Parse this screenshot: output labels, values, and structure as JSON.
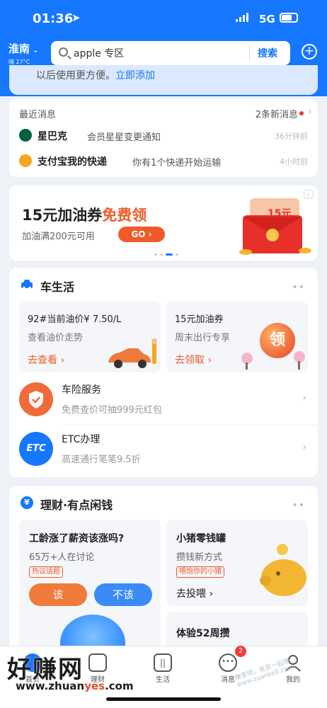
{
  "status_bar": {
    "time": "01:36",
    "network": "5G"
  },
  "header": {
    "city": "淮南",
    "weather": "晴 27°C",
    "search_query": "apple 专区",
    "search_button": "搜索"
  },
  "banner": {
    "text": "以后使用更方便。",
    "link": "立即添加"
  },
  "messages": {
    "title": "最近消息",
    "new_count": "2条新消息",
    "items": [
      {
        "name": "星巴克",
        "text": "会员星星变更通知",
        "time": "36分钟前"
      },
      {
        "name": "支付宝我的快递",
        "text": "你有1个快递开始运输",
        "time": "4小时前"
      }
    ]
  },
  "ad": {
    "title_main": "15元加油券",
    "title_accent": "免费领",
    "subtitle": "加油满200元可用",
    "button": "GO",
    "envelope_label": "15元"
  },
  "car_life": {
    "title": "车生活",
    "cards": [
      {
        "title": "92#当前油价¥ 7.50/L",
        "subtitle": "查看油价走势",
        "link": "去查看"
      },
      {
        "title": "15元加油券",
        "subtitle": "周末出行专享",
        "link": "去领取",
        "badge": "领"
      }
    ],
    "services": [
      {
        "title": "车险服务",
        "subtitle": "免费查价可抽999元红包"
      },
      {
        "title": "ETC办理",
        "subtitle": "高速通行笔笔9.5折",
        "icon_text": "ETC"
      }
    ]
  },
  "finance": {
    "title": "理财·有点闲钱",
    "poll": {
      "title": "工龄涨了薪资该涨吗?",
      "subtitle": "65万+人在讨论",
      "tag": "热议话题",
      "yes": "该",
      "no": "不该"
    },
    "piggy": {
      "title": "小猪零钱罐",
      "subtitle": "攒钱新方式",
      "tag": "喂饱你的小猪",
      "link": "去投喂"
    },
    "weekly": {
      "title": "体验52周攒"
    }
  },
  "tabbar": {
    "items": [
      {
        "label": "首页"
      },
      {
        "label": "理财"
      },
      {
        "label": "生活"
      },
      {
        "label": "消息"
      },
      {
        "label": "我的"
      }
    ],
    "message_badge": "2"
  },
  "watermark": {
    "main": "好赚网",
    "url_prefix": "www.zhuan",
    "url_accent": "yes",
    "url_suffix": ".com",
    "corner": "赚客吧，有奖一起赚 www.zuanke8.com"
  },
  "colors": {
    "brand_blue": "#1677ff",
    "accent_orange": "#f05a28",
    "background": "#eef1f6"
  }
}
